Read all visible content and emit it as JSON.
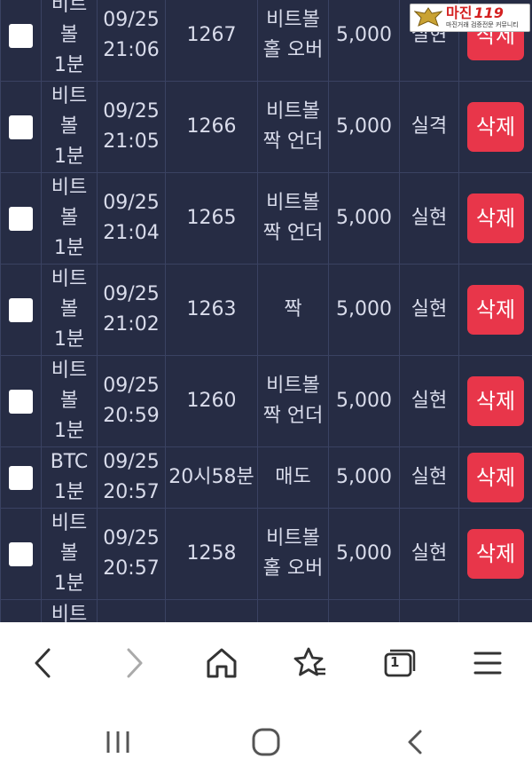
{
  "logo": {
    "word": "마진",
    "suffix": "119",
    "tagline": "마진거래 검증전문 커뮤니티"
  },
  "rows": [
    {
      "market": [
        "비트",
        "볼",
        "1분"
      ],
      "date": "09/25",
      "time": "21:06",
      "round": "1267",
      "pick": [
        "비트볼",
        "홀 오버"
      ],
      "amount": "5,000",
      "result": "실현",
      "result_status": "win",
      "delete": "삭제"
    },
    {
      "market": [
        "비트",
        "볼",
        "1분"
      ],
      "date": "09/25",
      "time": "21:05",
      "round": "1266",
      "pick": [
        "비트볼",
        "짝 언더"
      ],
      "amount": "5,000",
      "result": "실격",
      "result_status": "lose",
      "delete": "삭제"
    },
    {
      "market": [
        "비트",
        "볼",
        "1분"
      ],
      "date": "09/25",
      "time": "21:04",
      "round": "1265",
      "pick": [
        "비트볼",
        "짝 언더"
      ],
      "amount": "5,000",
      "result": "실현",
      "result_status": "win",
      "delete": "삭제"
    },
    {
      "market": [
        "비트",
        "볼",
        "1분"
      ],
      "date": "09/25",
      "time": "21:02",
      "round": "1263",
      "pick": [
        "짝"
      ],
      "amount": "5,000",
      "result": "실현",
      "result_status": "win",
      "delete": "삭제"
    },
    {
      "market": [
        "비트",
        "볼",
        "1분"
      ],
      "date": "09/25",
      "time": "20:59",
      "round": "1260",
      "pick": [
        "비트볼",
        "짝 언더"
      ],
      "amount": "5,000",
      "result": "실현",
      "result_status": "win",
      "delete": "삭제"
    },
    {
      "market": [
        "BTC",
        "1분"
      ],
      "date": "09/25",
      "time": "20:57",
      "round": "20시58분",
      "pick": [
        "매도"
      ],
      "amount": "5,000",
      "result": "실현",
      "result_status": "win",
      "delete": "삭제"
    },
    {
      "market": [
        "비트",
        "볼",
        "1분"
      ],
      "date": "09/25",
      "time": "20:57",
      "round": "1258",
      "pick": [
        "비트볼",
        "홀 오버"
      ],
      "amount": "5,000",
      "result": "실현",
      "result_status": "win",
      "delete": "삭제"
    }
  ],
  "partial_row": {
    "market": [
      "비트"
    ]
  },
  "colors": {
    "table_bg": "#262c44",
    "win": "#4fb24a",
    "lose": "#e53a3a",
    "delete_bg": "#e8364a"
  },
  "browser_bar": {
    "tab_count": "1",
    "icons": [
      "back-icon",
      "forward-icon",
      "home-icon",
      "bookmark-star-icon",
      "tabs-icon",
      "menu-icon"
    ]
  },
  "android_nav": {
    "icons": [
      "recents-icon",
      "home-circle-icon",
      "back-chevron-icon"
    ]
  }
}
